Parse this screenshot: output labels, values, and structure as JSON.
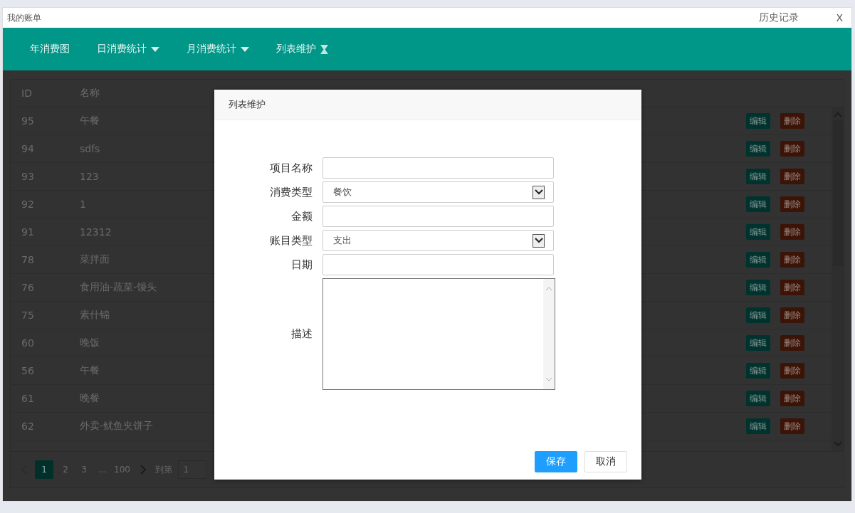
{
  "window": {
    "title": "我的账单",
    "history": "历史记录",
    "close": "X"
  },
  "nav": [
    {
      "label": "年消费图",
      "kind": "plain"
    },
    {
      "label": "日消费统计",
      "kind": "dropdown"
    },
    {
      "label": "月消费统计",
      "kind": "dropdown"
    },
    {
      "label": "列表维护",
      "kind": "hourglass"
    }
  ],
  "table": {
    "columns": [
      "ID",
      "名称"
    ],
    "rows": [
      {
        "id": "95",
        "name": "午餐",
        "edit": "编辑",
        "delete": "删除"
      },
      {
        "id": "94",
        "name": "sdfs",
        "edit": "编辑",
        "delete": "删除"
      },
      {
        "id": "93",
        "name": "123",
        "edit": "编辑",
        "delete": "删除"
      },
      {
        "id": "92",
        "name": "1",
        "edit": "编辑",
        "delete": "删除"
      },
      {
        "id": "91",
        "name": "12312",
        "edit": "编辑",
        "delete": "删除"
      },
      {
        "id": "78",
        "name": "菜拌面",
        "edit": "编辑",
        "delete": "删除"
      },
      {
        "id": "76",
        "name": "食用油-蔬菜-馒头",
        "edit": "编辑",
        "delete": "删除"
      },
      {
        "id": "75",
        "name": "素什锦",
        "edit": "编辑",
        "delete": "删除"
      },
      {
        "id": "60",
        "name": "晚饭",
        "edit": "编辑",
        "delete": "删除"
      },
      {
        "id": "56",
        "name": "午餐",
        "edit": "编辑",
        "delete": "删除"
      },
      {
        "id": "61",
        "name": "晚餐",
        "edit": "编辑",
        "delete": "删除"
      },
      {
        "id": "62",
        "name": "外卖-鱿鱼夹饼子",
        "edit": "编辑",
        "delete": "删除"
      }
    ]
  },
  "pagination": {
    "pages": [
      {
        "label": "1",
        "selected": true
      },
      {
        "label": "2",
        "selected": false
      },
      {
        "label": "3",
        "selected": false
      },
      {
        "label": "…",
        "selected": false
      },
      {
        "label": "100",
        "selected": false
      }
    ],
    "goto_label": "到第",
    "goto_value": "1"
  },
  "dialog": {
    "title": "列表维护",
    "fields": [
      {
        "label": "项目名称",
        "kind": "text"
      },
      {
        "label": "消费类型",
        "kind": "select",
        "value": "餐饮"
      },
      {
        "label": "金额",
        "kind": "text"
      },
      {
        "label": "账目类型",
        "kind": "select",
        "value": "支出"
      },
      {
        "label": "日期",
        "kind": "text"
      },
      {
        "label": "描述",
        "kind": "textarea"
      }
    ],
    "buttons": [
      {
        "label": "保存",
        "kind": "primary"
      },
      {
        "label": "取消",
        "kind": "default"
      }
    ]
  }
}
